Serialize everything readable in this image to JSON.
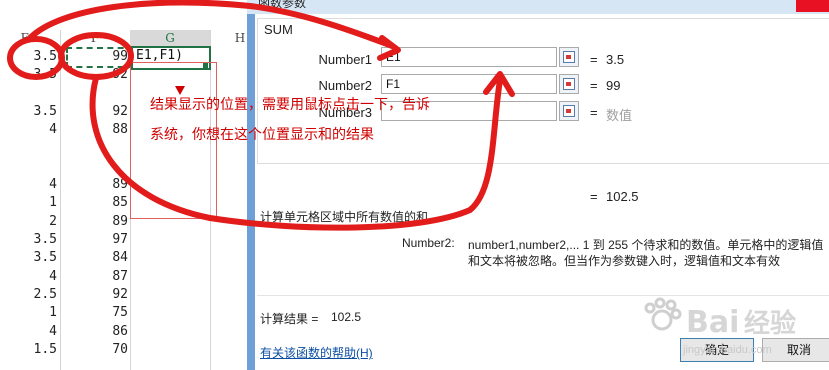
{
  "spreadsheet": {
    "column_headers": [
      "E",
      "F",
      "G",
      "H"
    ],
    "formula_text": "E1,F1)",
    "col_e": [
      "3.5",
      "3.5",
      "",
      "3.5",
      "4",
      "",
      "",
      "4",
      "1",
      "2",
      "3.5",
      "3.5",
      "4",
      "2.5",
      "1",
      "4",
      "1.5"
    ],
    "col_f": [
      "99",
      "92",
      "",
      "92",
      "88",
      "",
      "",
      "89",
      "85",
      "89",
      "97",
      "84",
      "87",
      "92",
      "75",
      "86",
      "70"
    ]
  },
  "dialog": {
    "title": "函数参数",
    "function_name": "SUM",
    "args": [
      {
        "label": "Number1",
        "value": "E1",
        "result": "3.5",
        "muted": false
      },
      {
        "label": "Number2",
        "value": "F1",
        "result": "99",
        "muted": false
      },
      {
        "label": "Number3",
        "value": "",
        "result": "数值",
        "muted": true
      }
    ],
    "formula_result": "102.5",
    "description": "计算单元格区域中所有数值的和",
    "arg_help_name": "Number2:",
    "arg_help_line1": "number1,number2,...  1 到 255 个待求和的数值。单元格中的逻辑值",
    "arg_help_line2": "和文本将被忽略。但当作为参数键入时，逻辑值和文本有效",
    "calc_label": "计算结果 =",
    "calc_value": "102.5",
    "help_link": "有关该函数的帮助(H)",
    "ok_label": "确定",
    "cancel_label": "取消"
  },
  "annotation": {
    "line1": "结果显示的位置，需要用鼠标点击一下，告诉",
    "line2": "系统，你想在这个位置显示和的结果",
    "color": "#d00000"
  },
  "watermark": {
    "url": "jingyan.baidu.com"
  }
}
